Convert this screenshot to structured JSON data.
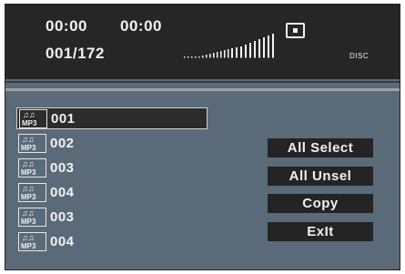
{
  "header": {
    "time_elapsed": "00:00",
    "time_total": "00:00",
    "track_counter": "001/172",
    "disc_label": "DISC",
    "stop_icon": "stop-square-icon"
  },
  "files": [
    {
      "name": "001",
      "icon": "mp3-file-icon",
      "selected": true
    },
    {
      "name": "002",
      "icon": "mp3-file-icon",
      "selected": false
    },
    {
      "name": "003",
      "icon": "mp3-file-icon",
      "selected": false
    },
    {
      "name": "004",
      "icon": "mp3-file-icon",
      "selected": false
    },
    {
      "name": "003",
      "icon": "mp3-file-icon",
      "selected": false
    },
    {
      "name": "004",
      "icon": "mp3-file-icon",
      "selected": false
    }
  ],
  "icon_text": {
    "notes": "♫♫",
    "label": "MP3"
  },
  "actions": {
    "all_select": "All Select",
    "all_unsel": "All Unsel",
    "copy": "Copy",
    "exit": "ExIt"
  },
  "colors": {
    "background": "#5a6a78",
    "topbar": "#262626",
    "text": "#f2f2f2",
    "button": "#242424"
  }
}
